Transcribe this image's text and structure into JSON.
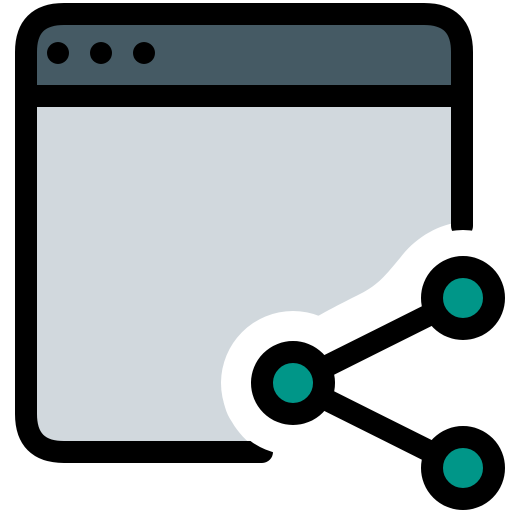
{
  "icon": {
    "name": "browser-window-share-icon",
    "parts": {
      "window": "browser-window",
      "title_bar": "title-bar",
      "dots": [
        "window-dot-1",
        "window-dot-2",
        "window-dot-3"
      ],
      "share_glyph": "share-icon"
    }
  },
  "colors": {
    "outline": "#000000",
    "title_bar": "#455a64",
    "window_body": "#d1d8dd",
    "share_node": "#009688",
    "halo": "#ffffff",
    "background": "#ffffff"
  }
}
